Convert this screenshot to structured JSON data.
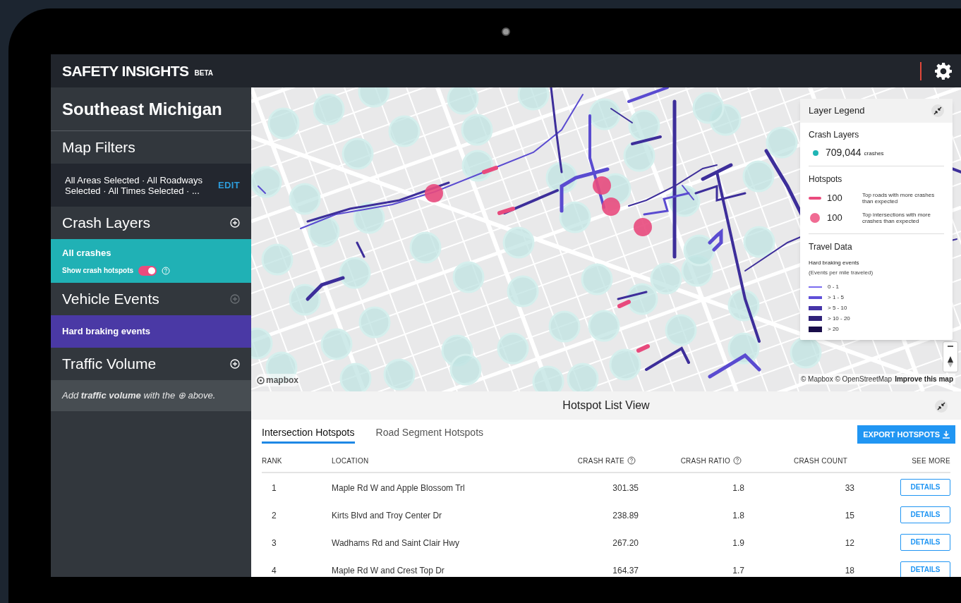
{
  "app": {
    "title": "SAFETY INSIGHTS",
    "badge": "BETA"
  },
  "sidebar": {
    "region": "Southeast Michigan",
    "sections": [
      {
        "kind": "filters",
        "title": "Map Filters",
        "summary": "All Areas Selected · All Roadways Selected · All Times Selected · ...",
        "action": "EDIT"
      },
      {
        "kind": "layer",
        "title": "Crash Layers",
        "add_disabled": false,
        "item": {
          "label": "All crashes",
          "color": "#20b1b5",
          "toggle": {
            "label": "Show crash hotspots",
            "on": true
          }
        }
      },
      {
        "kind": "layer",
        "title": "Vehicle Events",
        "add_disabled": true,
        "item": {
          "label": "Hard braking events",
          "color": "#4a39a5"
        }
      },
      {
        "kind": "empty",
        "title": "Traffic Volume",
        "add_disabled": false,
        "note": "Add **traffic volume** with the ⊕ above."
      }
    ]
  },
  "map": {
    "logo": "mapbox",
    "attribution": "© Mapbox © OpenStreetMap",
    "improve_link": "Improve this map",
    "legend": {
      "title": "Layer Legend",
      "crash_layers": {
        "title": "Crash Layers",
        "value": "709,044",
        "unit": "crashes",
        "color": "#1fb5b5"
      },
      "hotspots": {
        "title": "Hotspots",
        "items": [
          {
            "kind": "road",
            "value": "100",
            "description": "Top roads with more crashes than expected"
          },
          {
            "kind": "intersection",
            "value": "100",
            "description": "Top intersections with more crashes than expected"
          }
        ]
      },
      "travel": {
        "title": "Travel Data",
        "subtitle": "Hard braking events",
        "note": "(Events per mile traveled)",
        "bins": [
          {
            "label": "0 - 1",
            "color": "#7b6cf0"
          },
          {
            "label": "> 1 - 5",
            "color": "#5f4fd8"
          },
          {
            "label": "> 5 - 10",
            "color": "#4634a8"
          },
          {
            "label": "> 10 - 20",
            "color": "#30227a"
          },
          {
            "label": "> 20",
            "color": "#1a0e4a"
          }
        ]
      }
    }
  },
  "hotspot_list": {
    "title": "Hotspot List View",
    "tabs": [
      {
        "label": "Intersection Hotspots",
        "selected": true
      },
      {
        "label": "Road Segment Hotspots",
        "selected": false
      }
    ],
    "export": "EXPORT HOTSPOTS",
    "columns": [
      {
        "label": "RANK",
        "help": false
      },
      {
        "label": "LOCATION",
        "help": false
      },
      {
        "label": "CRASH RATE",
        "help": true
      },
      {
        "label": "CRASH RATIO",
        "help": true
      },
      {
        "label": "CRASH COUNT",
        "help": false
      },
      {
        "label": "SEE MORE",
        "help": false
      }
    ],
    "rows": [
      {
        "rank": "1",
        "location": "Maple Rd W and Apple Blossom Trl",
        "crash_rate": "301.35",
        "crash_ratio": "1.8",
        "crash_count": "33",
        "action": "DETAILS"
      },
      {
        "rank": "2",
        "location": "Kirts Blvd and Troy Center Dr",
        "crash_rate": "238.89",
        "crash_ratio": "1.8",
        "crash_count": "15",
        "action": "DETAILS"
      },
      {
        "rank": "3",
        "location": "Wadhams Rd and Saint Clair Hwy",
        "crash_rate": "267.20",
        "crash_ratio": "1.9",
        "crash_count": "12",
        "action": "DETAILS"
      },
      {
        "rank": "4",
        "location": "Maple Rd W and Crest Top Dr",
        "crash_rate": "164.37",
        "crash_ratio": "1.7",
        "crash_count": "18",
        "action": "DETAILS"
      }
    ]
  }
}
